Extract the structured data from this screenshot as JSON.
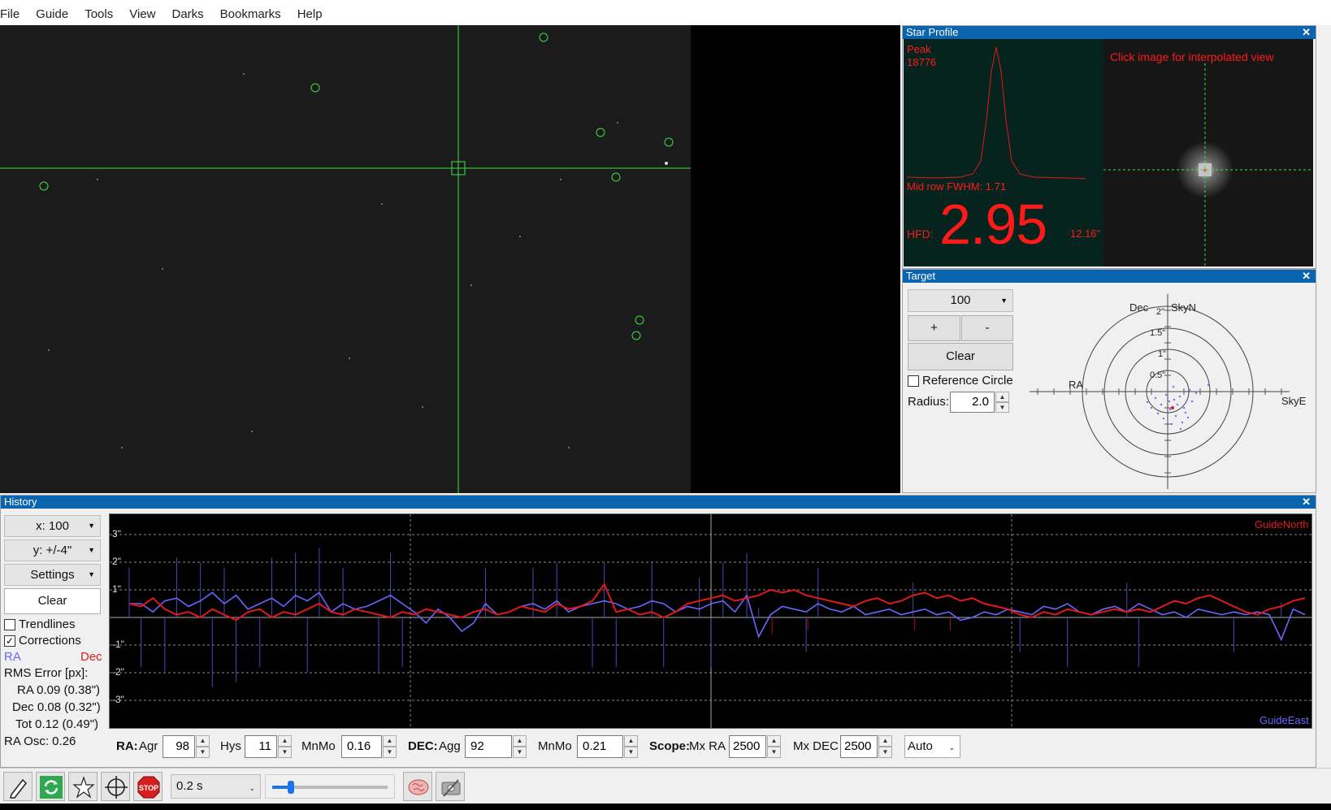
{
  "menu": [
    "File",
    "Guide",
    "Tools",
    "View",
    "Darks",
    "Bookmarks",
    "Help"
  ],
  "star_profile": {
    "title": "Star Profile",
    "peak_label": "Peak",
    "peak_value": "18776",
    "click_hint": "Click image for interpolated view",
    "fwhm": "Mid row FWHM: 1.71",
    "hfd_label": "HFD:",
    "hfd_value": "2.95",
    "hfd_arcsec": "12.16\""
  },
  "target": {
    "title": "Target",
    "zoom": "100",
    "plus": "+",
    "minus": "-",
    "clear": "Clear",
    "reference_circle": "Reference Circle",
    "radius_label": "Radius:",
    "radius_value": "2.0",
    "labels": {
      "dec": "Dec",
      "skyn": "SkyN",
      "ra": "RA",
      "skye": "SkyE"
    },
    "rings": [
      "2\"",
      "1.5\"",
      "1\"",
      "0.5\""
    ]
  },
  "history": {
    "title": "History",
    "x_scale": "x: 100",
    "y_scale": "y: +/-4\"",
    "settings": "Settings",
    "clear": "Clear",
    "trendlines": "Trendlines",
    "corrections": "Corrections",
    "ra_label": "RA",
    "dec_label": "Dec",
    "rms_title": "RMS Error [px]:",
    "rms_ra": "RA 0.09 (0.38\")",
    "rms_dec": "Dec 0.08 (0.32\")",
    "rms_tot": "Tot 0.12 (0.49\")",
    "ra_osc": "RA Osc: 0.26",
    "guide_north": "GuideNorth",
    "guide_east": "GuideEast",
    "y_ticks": [
      "3\"",
      "2\"",
      "1\"",
      "-1\"",
      "-2\"",
      "-3\""
    ]
  },
  "params": {
    "ra_label": "RA:",
    "agr": "Agr",
    "agr_value": "98",
    "hys": "Hys",
    "hys_value": "11",
    "mnmo": "MnMo",
    "ra_mnmo_value": "0.16",
    "dec_label": "DEC:",
    "agg": "Agg",
    "agg_value": "92",
    "dec_mnmo_value": "0.21",
    "scope_label": "Scope:",
    "mx_ra": "Mx RA",
    "mx_ra_value": "2500",
    "mx_dec": "Mx DEC",
    "mx_dec_value": "2500",
    "mode": "Auto"
  },
  "toolbar": {
    "exposure": "0.2 s",
    "stop": "STOP",
    "icons": [
      "pencil-icon",
      "loop-icon",
      "auto-select-star-icon",
      "crosshair-guide-icon",
      "stop-icon",
      "brain-icon",
      "camera-settings-icon"
    ]
  },
  "chart_data": {
    "type": "line",
    "title": "",
    "xlabel": "",
    "ylabel": "",
    "ylim": [
      -4,
      4
    ],
    "x": [
      0,
      1,
      2,
      3,
      4,
      5,
      6,
      7,
      8,
      9,
      10,
      11,
      12,
      13,
      14,
      15,
      16,
      17,
      18,
      19,
      20,
      21,
      22,
      23,
      24,
      25,
      26,
      27,
      28,
      29,
      30,
      31,
      32,
      33,
      34,
      35,
      36,
      37,
      38,
      39,
      40,
      41,
      42,
      43,
      44,
      45,
      46,
      47,
      48,
      49,
      50,
      51,
      52,
      53,
      54,
      55,
      56,
      57,
      58,
      59,
      60,
      61,
      62,
      63,
      64,
      65,
      66,
      67,
      68,
      69,
      70,
      71,
      72,
      73,
      74,
      75,
      76,
      77,
      78,
      79,
      80,
      81,
      82,
      83,
      84,
      85,
      86,
      87,
      88,
      89,
      90,
      91,
      92,
      93,
      94,
      95,
      96,
      97,
      98,
      99
    ],
    "series": [
      {
        "name": "RA",
        "color": "#6b66ff",
        "values": [
          0.5,
          0.5,
          0.2,
          0.6,
          0.7,
          0.4,
          0.6,
          0.9,
          0.5,
          0.8,
          0.3,
          0.5,
          0.7,
          0.4,
          0.8,
          0.6,
          0.9,
          0.2,
          0.5,
          0.3,
          0.4,
          0.6,
          0.8,
          0.5,
          0.2,
          -0.2,
          0.3,
          0.0,
          -0.5,
          -0.2,
          0.5,
          0.1,
          0.2,
          0.4,
          0.5,
          0.3,
          0.6,
          0.2,
          0.4,
          0.5,
          0.6,
          0.5,
          0.3,
          0.4,
          0.6,
          0.5,
          0.2,
          0.4,
          0.3,
          0.5,
          0.6,
          0.2,
          0.8,
          -0.7,
          0.1,
          0.4,
          0.3,
          0.2,
          0.5,
          0.3,
          0.2,
          0.4,
          0.1,
          0.2,
          0.3,
          0.1,
          0.2,
          0.3,
          0.1,
          0.2,
          -0.1,
          0.0,
          0.2,
          0.1,
          0.3,
          0.2,
          0.1,
          0.4,
          0.3,
          0.5,
          0.2,
          0.1,
          0.3,
          0.4,
          0.2,
          0.5,
          0.3,
          0.1,
          0.2,
          0.0,
          0.3,
          0.2,
          0.1,
          0.2,
          0.1,
          0.2,
          0.1,
          -0.8,
          0.3,
          0.1
        ]
      },
      {
        "name": "Dec",
        "color": "#e01a1a",
        "values": [
          0.5,
          0.4,
          0.7,
          0.3,
          0.1,
          0.2,
          0.0,
          0.3,
          0.1,
          -0.1,
          0.2,
          0.3,
          0.0,
          0.2,
          0.1,
          0.3,
          0.5,
          0.2,
          0.1,
          0.3,
          0.2,
          0.1,
          0.0,
          0.2,
          0.1,
          0.3,
          0.2,
          0.1,
          0.0,
          0.2,
          0.3,
          0.1,
          0.2,
          0.4,
          0.3,
          0.2,
          0.5,
          0.3,
          0.4,
          0.6,
          1.2,
          0.2,
          0.3,
          0.1,
          0.2,
          0.0,
          0.2,
          0.5,
          0.6,
          0.7,
          0.8,
          0.6,
          0.7,
          0.8,
          1.0,
          0.9,
          1.0,
          0.8,
          0.7,
          0.6,
          0.5,
          0.4,
          0.6,
          0.7,
          0.5,
          0.6,
          0.8,
          0.9,
          0.7,
          0.8,
          0.6,
          0.7,
          0.5,
          0.4,
          0.3,
          0.1,
          0.0,
          0.2,
          0.1,
          0.3,
          0.2,
          0.1,
          0.2,
          0.3,
          0.2,
          0.3,
          0.2,
          0.4,
          0.6,
          0.5,
          0.7,
          0.8,
          0.6,
          0.4,
          0.2,
          0.1,
          0.3,
          0.4,
          0.6,
          0.7
        ]
      }
    ]
  }
}
